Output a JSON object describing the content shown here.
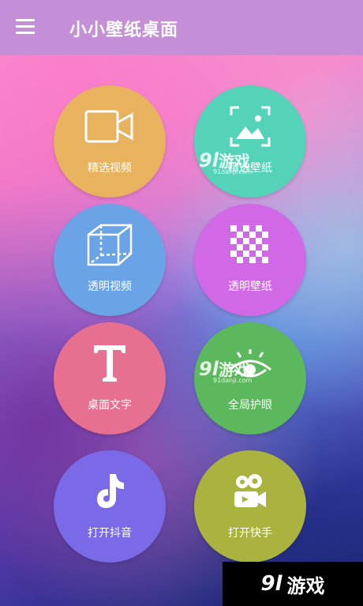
{
  "header": {
    "title": "小小壁纸桌面",
    "menu_icon": "hamburger-menu-icon",
    "color": "#c58fd8"
  },
  "tiles": [
    {
      "label": "精选视频",
      "icon": "video-camera-icon",
      "color": "#e9b25f"
    },
    {
      "label": "精选壁纸",
      "icon": "image-frame-icon",
      "color": "#55d3b8"
    },
    {
      "label": "透明视频",
      "icon": "cube-icon",
      "color": "#6aa4e6"
    },
    {
      "label": "透明壁纸",
      "icon": "checkerboard-icon",
      "color": "#d168e6"
    },
    {
      "label": "桌面文字",
      "icon": "text-t-icon",
      "color": "#e76f8f"
    },
    {
      "label": "全局护眼",
      "icon": "eye-icon",
      "color": "#5cb85c"
    },
    {
      "label": "打开抖音",
      "icon": "tiktok-icon",
      "color": "#7a6ae8"
    },
    {
      "label": "打开快手",
      "icon": "kuaishou-icon",
      "color": "#a9b33e"
    }
  ],
  "watermark": {
    "logo_number": "9l",
    "logo_text": "游戏",
    "site": "91danji.com"
  }
}
